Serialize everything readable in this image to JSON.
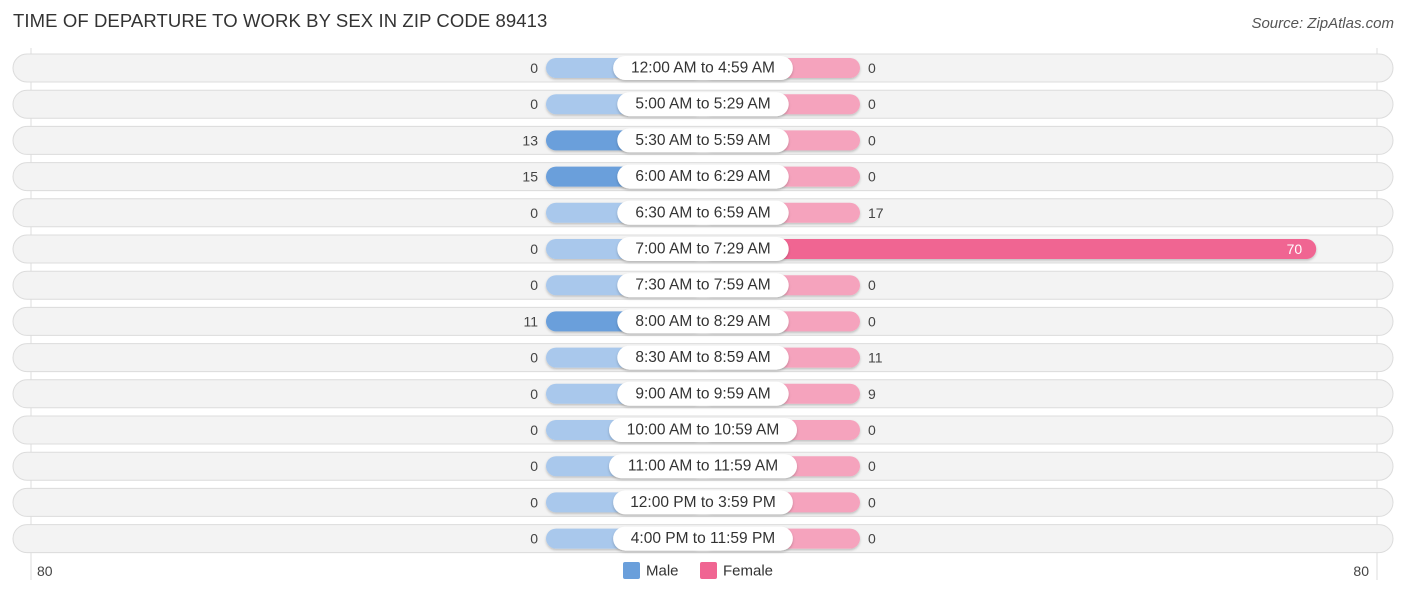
{
  "chart_data": {
    "type": "bar",
    "orientation": "horizontal-diverging",
    "title": "TIME OF DEPARTURE TO WORK BY SEX IN ZIP CODE 89413",
    "source": "Source: ZipAtlas.com",
    "categories": [
      "12:00 AM to 4:59 AM",
      "5:00 AM to 5:29 AM",
      "5:30 AM to 5:59 AM",
      "6:00 AM to 6:29 AM",
      "6:30 AM to 6:59 AM",
      "7:00 AM to 7:29 AM",
      "7:30 AM to 7:59 AM",
      "8:00 AM to 8:29 AM",
      "8:30 AM to 8:59 AM",
      "9:00 AM to 9:59 AM",
      "10:00 AM to 10:59 AM",
      "11:00 AM to 11:59 AM",
      "12:00 PM to 3:59 PM",
      "4:00 PM to 11:59 PM"
    ],
    "series": [
      {
        "name": "Male",
        "color": "#6a9fdb",
        "color_light": "#a9c8ec",
        "values": [
          0,
          0,
          13,
          15,
          0,
          0,
          0,
          11,
          0,
          0,
          0,
          0,
          0,
          0
        ]
      },
      {
        "name": "Female",
        "color": "#f06592",
        "color_light": "#f5a3bd",
        "values": [
          0,
          0,
          0,
          0,
          17,
          70,
          0,
          0,
          11,
          9,
          0,
          0,
          0,
          0
        ]
      }
    ],
    "xlim": [
      -80,
      80
    ],
    "axis_labels": {
      "left": "80",
      "right": "80"
    },
    "legend": {
      "placement": "bottom-center",
      "items": [
        "Male",
        "Female"
      ]
    },
    "grid": false
  }
}
